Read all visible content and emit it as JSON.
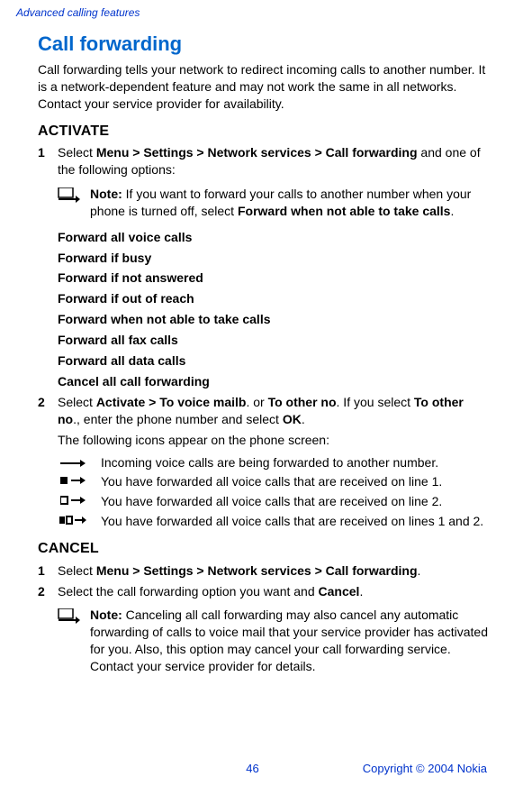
{
  "header": "Advanced calling features",
  "sectionTitle": "Call forwarding",
  "intro": "Call forwarding tells your network to redirect incoming calls to another number. It is a network-dependent feature and may not work the same in all networks. Contact your service provider for availability.",
  "activate": {
    "heading": "ACTIVATE",
    "step1_num": "1",
    "step1_prefix": "Select ",
    "step1_bold": "Menu > Settings > Network services > Call forwarding",
    "step1_suffix": " and one of the following options:",
    "note_bold": "Note:",
    "note_text": " If you want to forward your calls to another number when your phone is turned off, select ",
    "note_bold2": "Forward when not able to take calls",
    "note_period": ".",
    "options": [
      "Forward all voice calls",
      "Forward if busy",
      "Forward if not answered",
      "Forward if out of reach",
      "Forward when not able to take calls",
      "Forward all fax calls",
      "Forward all data calls",
      "Cancel all call forwarding"
    ],
    "step2_num": "2",
    "step2_a": "Select ",
    "step2_b": "Activate > To voice mailb",
    "step2_c": ". or ",
    "step2_d": "To other no",
    "step2_e": ". If you select ",
    "step2_f": "To other no",
    "step2_g": "., enter the phone number and select ",
    "step2_h": "OK",
    "step2_i": ".",
    "iconsIntro": "The following icons appear on the phone screen:",
    "iconDescs": [
      "Incoming voice calls are being forwarded to another number.",
      "You have forwarded all voice calls that are received on line 1.",
      "You have forwarded all voice calls that are received on line 2.",
      "You have forwarded all voice calls that are received on lines 1 and 2."
    ]
  },
  "cancel": {
    "heading": "CANCEL",
    "step1_num": "1",
    "step1_a": "Select ",
    "step1_b": "Menu > Settings > Network services > Call forwarding",
    "step1_c": ".",
    "step2_num": "2",
    "step2_a": "Select the call forwarding option you want and ",
    "step2_b": "Cancel",
    "step2_c": ".",
    "note_bold": "Note:",
    "note_text": " Canceling all call forwarding may also cancel any automatic forwarding of calls to voice mail that your service provider has activated for you. Also, this option may cancel your call forwarding service. Contact your service provider for details."
  },
  "footer": {
    "page": "46",
    "copyright": "Copyright © 2004 Nokia"
  }
}
